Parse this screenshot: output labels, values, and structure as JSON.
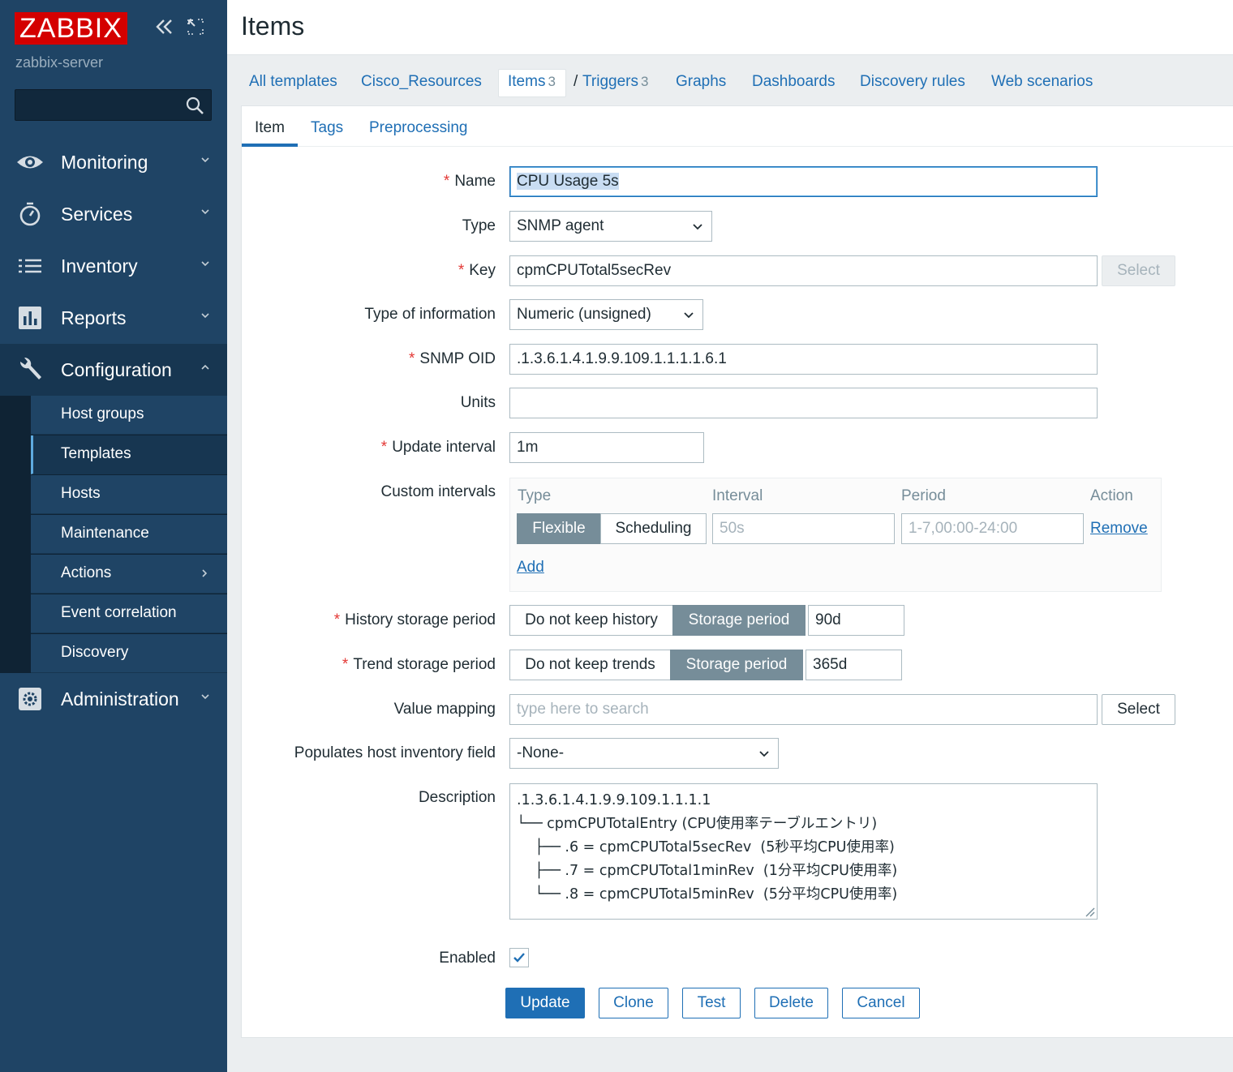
{
  "sidebar": {
    "logo": "ZABBIX",
    "server_name": "zabbix-server",
    "search_placeholder": "",
    "menu": [
      {
        "label": "Monitoring"
      },
      {
        "label": "Services"
      },
      {
        "label": "Inventory"
      },
      {
        "label": "Reports"
      },
      {
        "label": "Configuration"
      },
      {
        "label": "Administration"
      }
    ],
    "submenu": [
      {
        "label": "Host groups"
      },
      {
        "label": "Templates"
      },
      {
        "label": "Hosts"
      },
      {
        "label": "Maintenance"
      },
      {
        "label": "Actions"
      },
      {
        "label": "Event correlation"
      },
      {
        "label": "Discovery"
      }
    ]
  },
  "header": {
    "title": "Items"
  },
  "nav": {
    "all_templates": "All templates",
    "separator": "/",
    "template": "Cisco_Resources",
    "items": "Items",
    "items_count": "3",
    "triggers": "Triggers",
    "triggers_count": "3",
    "graphs": "Graphs",
    "dashboards": "Dashboards",
    "discovery_rules": "Discovery rules",
    "web_scenarios": "Web scenarios"
  },
  "form_tabs": {
    "item": "Item",
    "tags": "Tags",
    "preprocessing": "Preprocessing"
  },
  "form": {
    "required_mark": "*",
    "name_label": "Name",
    "name_value": "CPU Usage 5s",
    "type_label": "Type",
    "type_value": "SNMP agent",
    "key_label": "Key",
    "key_value": "cpmCPUTotal5secRev",
    "key_select": "Select",
    "type_info_label": "Type of information",
    "type_info_value": "Numeric (unsigned)",
    "snmp_oid_label": "SNMP OID",
    "snmp_oid_value": ".1.3.6.1.4.1.9.9.109.1.1.1.1.6.1",
    "units_label": "Units",
    "units_value": "",
    "update_interval_label": "Update interval",
    "update_interval_value": "1m",
    "custom_intervals_label": "Custom intervals",
    "ci_headers": {
      "type": "Type",
      "interval": "Interval",
      "period": "Period",
      "action": "Action"
    },
    "ci_flexible": "Flexible",
    "ci_scheduling": "Scheduling",
    "ci_interval_placeholder": "50s",
    "ci_period_placeholder": "1-7,00:00-24:00",
    "ci_remove": "Remove",
    "ci_add": "Add",
    "history_label": "History storage period",
    "history_off": "Do not keep history",
    "history_on": "Storage period",
    "history_value": "90d",
    "trend_label": "Trend storage period",
    "trend_off": "Do not keep trends",
    "trend_on": "Storage period",
    "trend_value": "365d",
    "value_mapping_label": "Value mapping",
    "value_mapping_placeholder": "type here to search",
    "value_mapping_select": "Select",
    "inventory_label": "Populates host inventory field",
    "inventory_value": "-None-",
    "description_label": "Description",
    "description_value": ".1.3.6.1.4.1.9.9.109.1.1.1.1\n└── cpmCPUTotalEntry (CPU使用率テーブルエントリ)\n    ├── .6 = cpmCPUTotal5secRev  (5秒平均CPU使用率)\n    ├── .7 = cpmCPUTotal1minRev  (1分平均CPU使用率)\n    └── .8 = cpmCPUTotal5minRev  (5分平均CPU使用率)",
    "enabled_label": "Enabled",
    "enabled": true
  },
  "actions": {
    "update": "Update",
    "clone": "Clone",
    "test": "Test",
    "delete": "Delete",
    "cancel": "Cancel"
  },
  "colors": {
    "sidebar": "#1f4465",
    "logo": "#d40000",
    "link": "#1f6fb5",
    "required": "#e33734",
    "segment_active": "#768d99"
  }
}
